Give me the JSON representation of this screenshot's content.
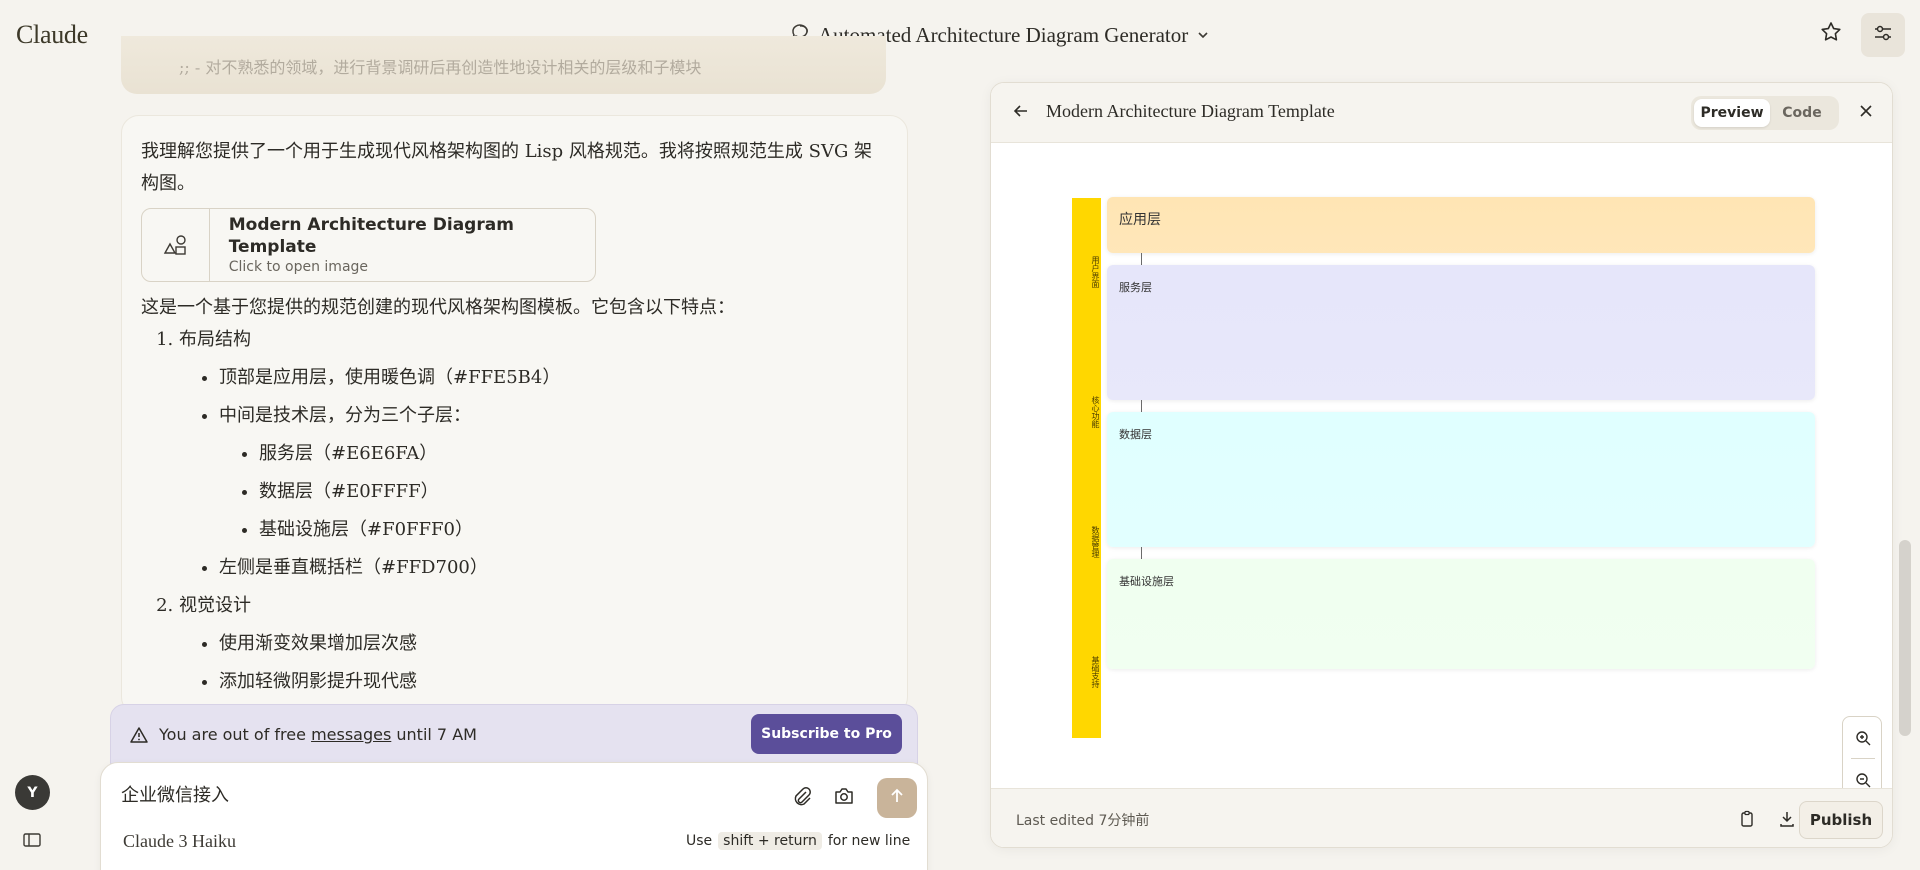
{
  "app": {
    "brand": "Claude"
  },
  "conversation": {
    "title": "Automated Architecture Diagram Generator"
  },
  "previous_message": {
    "text": ";; - 对不熟悉的领域，进行背景调研后再创造性地设计相关的层级和子模块"
  },
  "assistant_message": {
    "intro": "我理解您提供了一个用于生成现代风格架构图的 Lisp 风格规范。我将按照规范生成 SVG 架构图。",
    "artifact_card": {
      "title": "Modern Architecture Diagram Template",
      "subtitle": "Click to open image"
    },
    "summary": "这是一个基于您提供的规范创建的现代风格架构图模板。它包含以下特点：",
    "features": [
      {
        "title": "布局结构",
        "items": [
          {
            "text": "顶部是应用层，使用暖色调（#FFE5B4）"
          },
          {
            "text": "中间是技术层，分为三个子层：",
            "sub": [
              "服务层（#E6E6FA）",
              "数据层（#E0FFFF）",
              "基础设施层（#F0FFF0）"
            ]
          },
          {
            "text": "左侧是垂直概括栏（#FFD700）"
          }
        ]
      },
      {
        "title": "视觉设计",
        "items": [
          {
            "text": "使用渐变效果增加层次感"
          },
          {
            "text": "添加轻微阴影提升现代感"
          }
        ]
      }
    ]
  },
  "limit_banner": {
    "text_before": "You are out of free ",
    "link": "messages",
    "text_after": " until 7 AM",
    "button": "Subscribe to Pro"
  },
  "composer": {
    "input_value": "企业微信接入",
    "model": "Claude 3 Haiku",
    "hint_before": "Use",
    "hint_keys": "shift + return",
    "hint_after": "for new line"
  },
  "artifact_panel": {
    "title": "Modern Architecture Diagram Template",
    "tabs": {
      "preview": "Preview",
      "code": "Code"
    },
    "diagram": {
      "sidebar_color": "#FFD700",
      "sidebar_labels": [
        "用户界面",
        "核心功能",
        "数据管理",
        "基础支持"
      ],
      "layers": [
        {
          "name": "应用层",
          "color": "#FFE5B4"
        },
        {
          "name": "服务层",
          "color": "#E6E6FA"
        },
        {
          "name": "数据层",
          "color": "#E0FFFF"
        },
        {
          "name": "基础设施层",
          "color": "#F0FFF0"
        }
      ]
    },
    "footer": {
      "last_edited": "Last edited 7分钟前",
      "publish": "Publish"
    }
  }
}
